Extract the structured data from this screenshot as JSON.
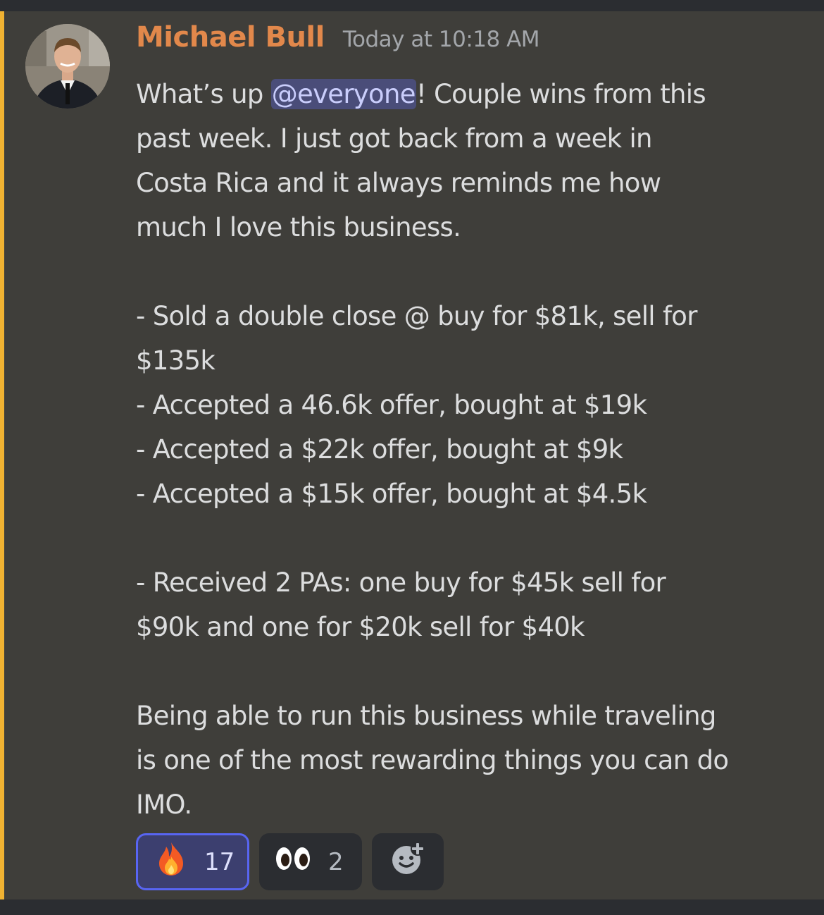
{
  "message": {
    "author": "Michael Bull",
    "timestamp": "Today at 10:18 AM",
    "lines": [
      {
        "before": "What’s up ",
        "mention": "@everyone",
        "after": "! Couple wins from this"
      },
      {
        "text": "past week. I just got back from a week in"
      },
      {
        "text": "Costa Rica and it always reminds me how"
      },
      {
        "text": "much I love this business."
      },
      {
        "text": ""
      },
      {
        "text": "- Sold a double close @ buy for $81k, sell for"
      },
      {
        "text": "$135k"
      },
      {
        "text": "- Accepted a 46.6k offer, bought at $19k"
      },
      {
        "text": "- Accepted a $22k offer, bought at $9k"
      },
      {
        "text": "- Accepted a $15k offer, bought at $4.5k"
      },
      {
        "text": ""
      },
      {
        "text": "- Received 2 PAs: one buy for $45k sell for"
      },
      {
        "text": "$90k and one for $20k sell for $40k"
      },
      {
        "text": ""
      },
      {
        "text": "Being able to run this business while traveling"
      },
      {
        "text": "is one of the most rewarding things you can do"
      },
      {
        "text": "IMO."
      }
    ]
  },
  "reactions": [
    {
      "icon": "fire-icon",
      "emoji": "🔥",
      "count": "17",
      "active": true
    },
    {
      "icon": "eyes-icon",
      "emoji": "👀",
      "count": "2",
      "active": false
    }
  ],
  "colors": {
    "username": "#e2884b",
    "mention_highlight_bar": "#f0b232",
    "mention_bg": "#4a4d79",
    "active_reaction_border": "#5865f2"
  }
}
